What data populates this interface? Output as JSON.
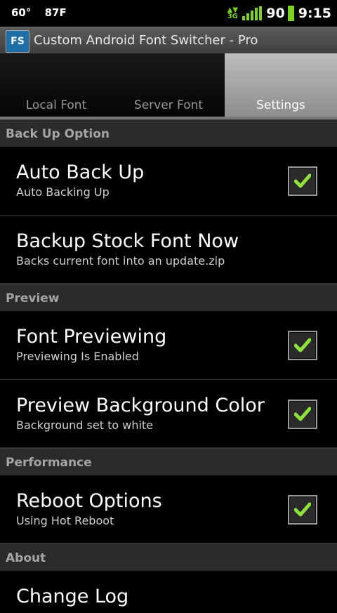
{
  "status_bar": {
    "temp_c": "60°",
    "temp_f": "87F",
    "network": "3G",
    "battery": "90",
    "time": "9:15"
  },
  "app_bar": {
    "icon_text": "FS",
    "title": "Custom Android Font Switcher - Pro"
  },
  "tabs": [
    {
      "label": "Local Font",
      "active": false
    },
    {
      "label": "Server Font",
      "active": false
    },
    {
      "label": "Settings",
      "active": true
    }
  ],
  "sections": [
    {
      "header": "Back Up Option",
      "items": [
        {
          "title": "Auto Back Up",
          "summary": "Auto Backing Up",
          "checked": true
        },
        {
          "title": "Backup Stock Font Now",
          "summary": "Backs current font into an update.zip"
        }
      ]
    },
    {
      "header": "Preview",
      "items": [
        {
          "title": "Font Previewing",
          "summary": "Previewing Is Enabled",
          "checked": true
        },
        {
          "title": "Preview Background Color",
          "summary": "Background set to white",
          "checked": true
        }
      ]
    },
    {
      "header": "Performance",
      "items": [
        {
          "title": "Reboot Options",
          "summary": "Using Hot Reboot",
          "checked": true
        }
      ]
    },
    {
      "header": "About",
      "items": [
        {
          "title": "Change Log"
        }
      ]
    }
  ],
  "colors": {
    "accent_green": "#7dd320",
    "check_green": "#8ee03a"
  }
}
